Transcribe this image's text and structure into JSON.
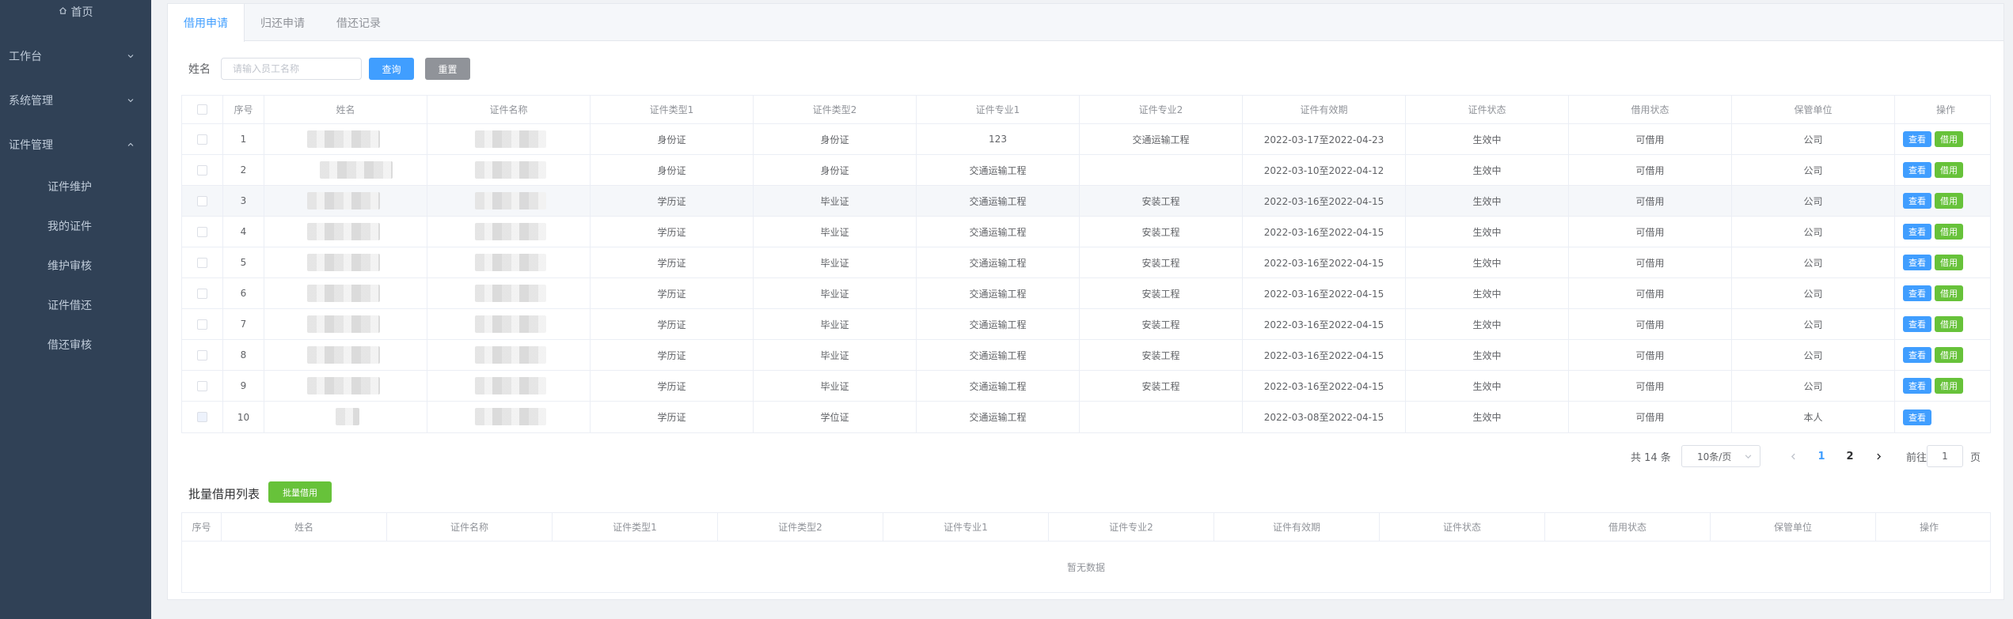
{
  "sidebar": {
    "home": "首页",
    "groups": [
      {
        "label": "工作台",
        "expanded": false
      },
      {
        "label": "系统管理",
        "expanded": false
      },
      {
        "label": "证件管理",
        "expanded": true
      }
    ],
    "items": [
      "证件维护",
      "我的证件",
      "维护审核",
      "证件借还",
      "借还审核"
    ]
  },
  "tabs": [
    "借用申请",
    "归还申请",
    "借还记录"
  ],
  "search": {
    "label": "姓名",
    "placeholder": "请输入员工名称",
    "query": "查询",
    "reset": "重置"
  },
  "table": {
    "headers": [
      "序号",
      "姓名",
      "证件名称",
      "证件类型1",
      "证件类型2",
      "证件专业1",
      "证件专业2",
      "证件有效期",
      "证件状态",
      "借用状态",
      "保管单位",
      "操作"
    ],
    "view_label": "查看",
    "borrow_label": "借用",
    "rows": [
      {
        "no": "1",
        "type1": "身份证",
        "type2": "身份证",
        "major1": "123",
        "major2": "交通运输工程",
        "validity": "2022-03-17至2022-04-23",
        "status": "生效中",
        "borrow": "可借用",
        "unit": "公司",
        "can_borrow": true
      },
      {
        "no": "2",
        "type1": "身份证",
        "type2": "身份证",
        "major1": "交通运输工程",
        "major2": "",
        "validity": "2022-03-10至2022-04-12",
        "status": "生效中",
        "borrow": "可借用",
        "unit": "公司",
        "can_borrow": true
      },
      {
        "no": "3",
        "type1": "学历证",
        "type2": "毕业证",
        "major1": "交通运输工程",
        "major2": "安装工程",
        "validity": "2022-03-16至2022-04-15",
        "status": "生效中",
        "borrow": "可借用",
        "unit": "公司",
        "can_borrow": true
      },
      {
        "no": "4",
        "type1": "学历证",
        "type2": "毕业证",
        "major1": "交通运输工程",
        "major2": "安装工程",
        "validity": "2022-03-16至2022-04-15",
        "status": "生效中",
        "borrow": "可借用",
        "unit": "公司",
        "can_borrow": true
      },
      {
        "no": "5",
        "type1": "学历证",
        "type2": "毕业证",
        "major1": "交通运输工程",
        "major2": "安装工程",
        "validity": "2022-03-16至2022-04-15",
        "status": "生效中",
        "borrow": "可借用",
        "unit": "公司",
        "can_borrow": true
      },
      {
        "no": "6",
        "type1": "学历证",
        "type2": "毕业证",
        "major1": "交通运输工程",
        "major2": "安装工程",
        "validity": "2022-03-16至2022-04-15",
        "status": "生效中",
        "borrow": "可借用",
        "unit": "公司",
        "can_borrow": true
      },
      {
        "no": "7",
        "type1": "学历证",
        "type2": "毕业证",
        "major1": "交通运输工程",
        "major2": "安装工程",
        "validity": "2022-03-16至2022-04-15",
        "status": "生效中",
        "borrow": "可借用",
        "unit": "公司",
        "can_borrow": true
      },
      {
        "no": "8",
        "type1": "学历证",
        "type2": "毕业证",
        "major1": "交通运输工程",
        "major2": "安装工程",
        "validity": "2022-03-16至2022-04-15",
        "status": "生效中",
        "borrow": "可借用",
        "unit": "公司",
        "can_borrow": true
      },
      {
        "no": "9",
        "type1": "学历证",
        "type2": "毕业证",
        "major1": "交通运输工程",
        "major2": "安装工程",
        "validity": "2022-03-16至2022-04-15",
        "status": "生效中",
        "borrow": "可借用",
        "unit": "公司",
        "can_borrow": true
      },
      {
        "no": "10",
        "type1": "学历证",
        "type2": "学位证",
        "major1": "交通运输工程",
        "major2": "",
        "validity": "2022-03-08至2022-04-15",
        "status": "生效中",
        "borrow": "可借用",
        "unit": "本人",
        "can_borrow": false
      }
    ]
  },
  "pagination": {
    "total": "共 14 条",
    "page_size": "10条/页",
    "pages": [
      "1",
      "2"
    ],
    "current": "1",
    "goto": "前往",
    "goto_value": "1",
    "unit": "页"
  },
  "batch": {
    "title": "批量借用列表",
    "button": "批量借用",
    "headers": [
      "序号",
      "姓名",
      "证件名称",
      "证件类型1",
      "证件类型2",
      "证件专业1",
      "证件专业2",
      "证件有效期",
      "证件状态",
      "借用状态",
      "保管单位",
      "操作"
    ],
    "empty": "暂无数据"
  },
  "colors": {
    "sidebar_bg": "#304156",
    "primary": "#409eff",
    "success": "#67c23a",
    "info": "#909399"
  }
}
